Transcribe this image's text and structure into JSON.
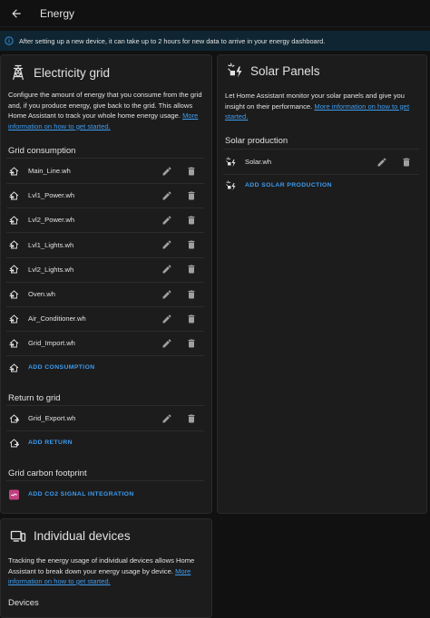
{
  "header": {
    "title": "Energy",
    "back_icon": "arrow-left-icon"
  },
  "banner": {
    "text": "After setting up a new device, it can take up to 2 hours for new data to arrive in your energy dashboard."
  },
  "grid": {
    "title": "Electricity grid",
    "desc": "Configure the amount of energy that you consume from the grid and, if you produce energy, give back to the grid. This allows Home Assistant to track your whole home energy usage.",
    "link": "More information on how to get started.",
    "consumption_title": "Grid consumption",
    "consumption": [
      "Main_Line.wh",
      "Lvl1_Power.wh",
      "Lvl2_Power.wh",
      "Lvl1_Lights.wh",
      "Lvl2_Lights.wh",
      "Oven.wh",
      "Air_Conditioner.wh",
      "Grid_Import.wh"
    ],
    "add_consumption": "ADD CONSUMPTION",
    "return_title": "Return to grid",
    "returns": [
      "Grid_Export.wh"
    ],
    "add_return": "ADD RETURN",
    "carbon_title": "Grid carbon footprint",
    "add_co2": "ADD CO2 SIGNAL INTEGRATION"
  },
  "solar": {
    "title": "Solar Panels",
    "desc": "Let Home Assistant monitor your solar panels and give you insight on their performance.",
    "link": "More information on how to get started.",
    "production_title": "Solar production",
    "production": [
      "Solar.wh"
    ],
    "add_solar": "ADD SOLAR PRODUCTION"
  },
  "devices": {
    "title": "Individual devices",
    "desc": "Tracking the energy usage of individual devices allows Home Assistant to break down your energy usage by device.",
    "link": "More information on how to get started.",
    "section_title": "Devices"
  },
  "colors": {
    "accent": "#3d9cf0",
    "card": "#1c1c1c",
    "background": "#111111",
    "banner": "#0f2632"
  }
}
